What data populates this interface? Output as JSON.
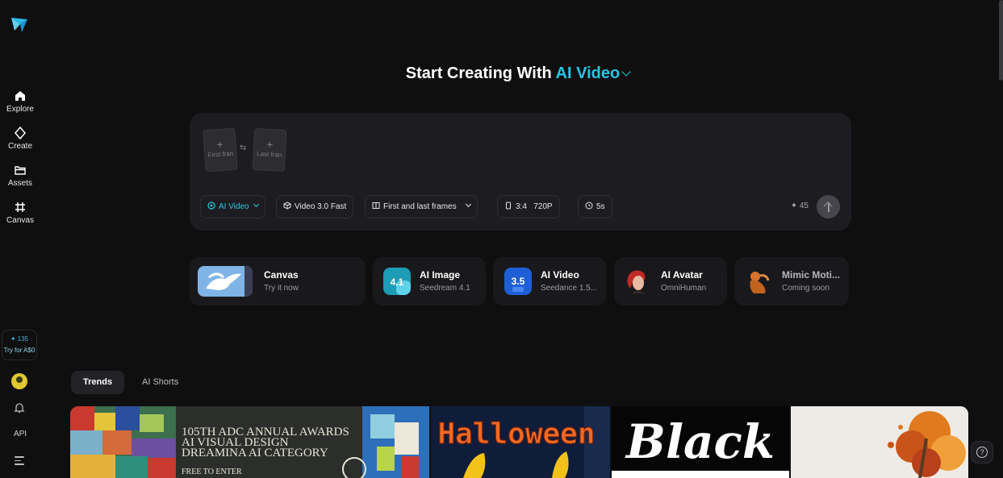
{
  "sidebar": {
    "nav": [
      {
        "label": "Explore",
        "icon": "home-icon"
      },
      {
        "label": "Create",
        "icon": "sparkle-icon"
      },
      {
        "label": "Assets",
        "icon": "folder-icon"
      },
      {
        "label": "Canvas",
        "icon": "frame-icon"
      }
    ],
    "credits": "135",
    "try_label": "Try for A$0",
    "api_label": "API"
  },
  "headline": {
    "prefix": "Start Creating With",
    "mode": "AI Video"
  },
  "prompt": {
    "first_frame": "First fran",
    "last_frame": "Last fran",
    "controls": {
      "mode": "AI Video",
      "model": "Video 3.0 Fast",
      "frames": "First and last frames",
      "ratio": "3:4",
      "resolution": "720P",
      "duration": "5s"
    },
    "cost": "45"
  },
  "tools": [
    {
      "title": "Canvas",
      "subtitle": "Try it now"
    },
    {
      "title": "AI Image",
      "subtitle": "Seedream 4.1",
      "badge": "4.1"
    },
    {
      "title": "AI Video",
      "subtitle": "Seedance 1.5...",
      "badge": "3.5"
    },
    {
      "title": "AI Avatar",
      "subtitle": "OmniHuman"
    },
    {
      "title": "Mimic Moti...",
      "subtitle": "Coming soon"
    }
  ],
  "tabs": [
    "Trends",
    "AI Shorts"
  ],
  "gallery": {
    "adc_line1": "105TH ADC ANNUAL AWARDS",
    "adc_line2": "AI VISUAL DESIGN",
    "adc_line3": "DREAMINA AI CATEGORY",
    "adc_line4": "FREE TO ENTER",
    "halloween": "Halloween",
    "black_friday": "Black"
  },
  "colors": {
    "accent": "#27c4e3",
    "background": "#0f0f10",
    "card": "#1d1d21"
  }
}
